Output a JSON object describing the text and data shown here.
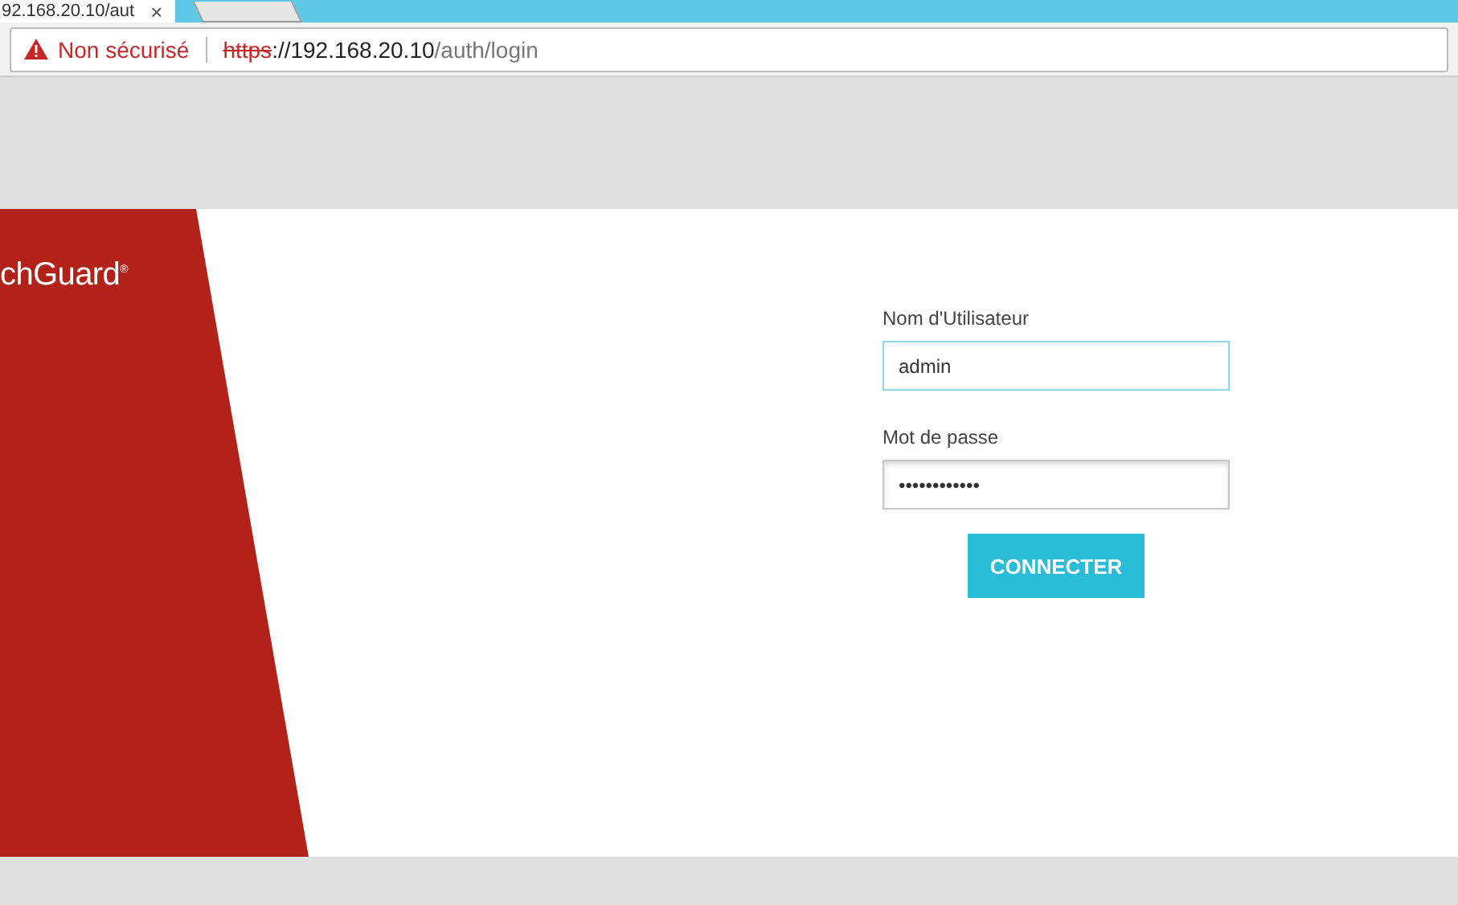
{
  "browser": {
    "tab": {
      "title": "92.168.20.10/aut",
      "close": "×"
    },
    "security": "Non sécurisé",
    "url": {
      "scheme": "https",
      "rest": "://192.168.20.10",
      "path": "/auth/login"
    }
  },
  "brand": {
    "logo": "chGuard$^{®}$"
  },
  "login": {
    "fields": [
      {
        "label": "Nom d'Utilisateur",
        "value": "admin",
        "focused": true
      },
      {
        "label": "Mot de passe",
        "value": "••••••••••••",
        "focused": false
      }
    ],
    "button": "CONNECTER"
  }
}
